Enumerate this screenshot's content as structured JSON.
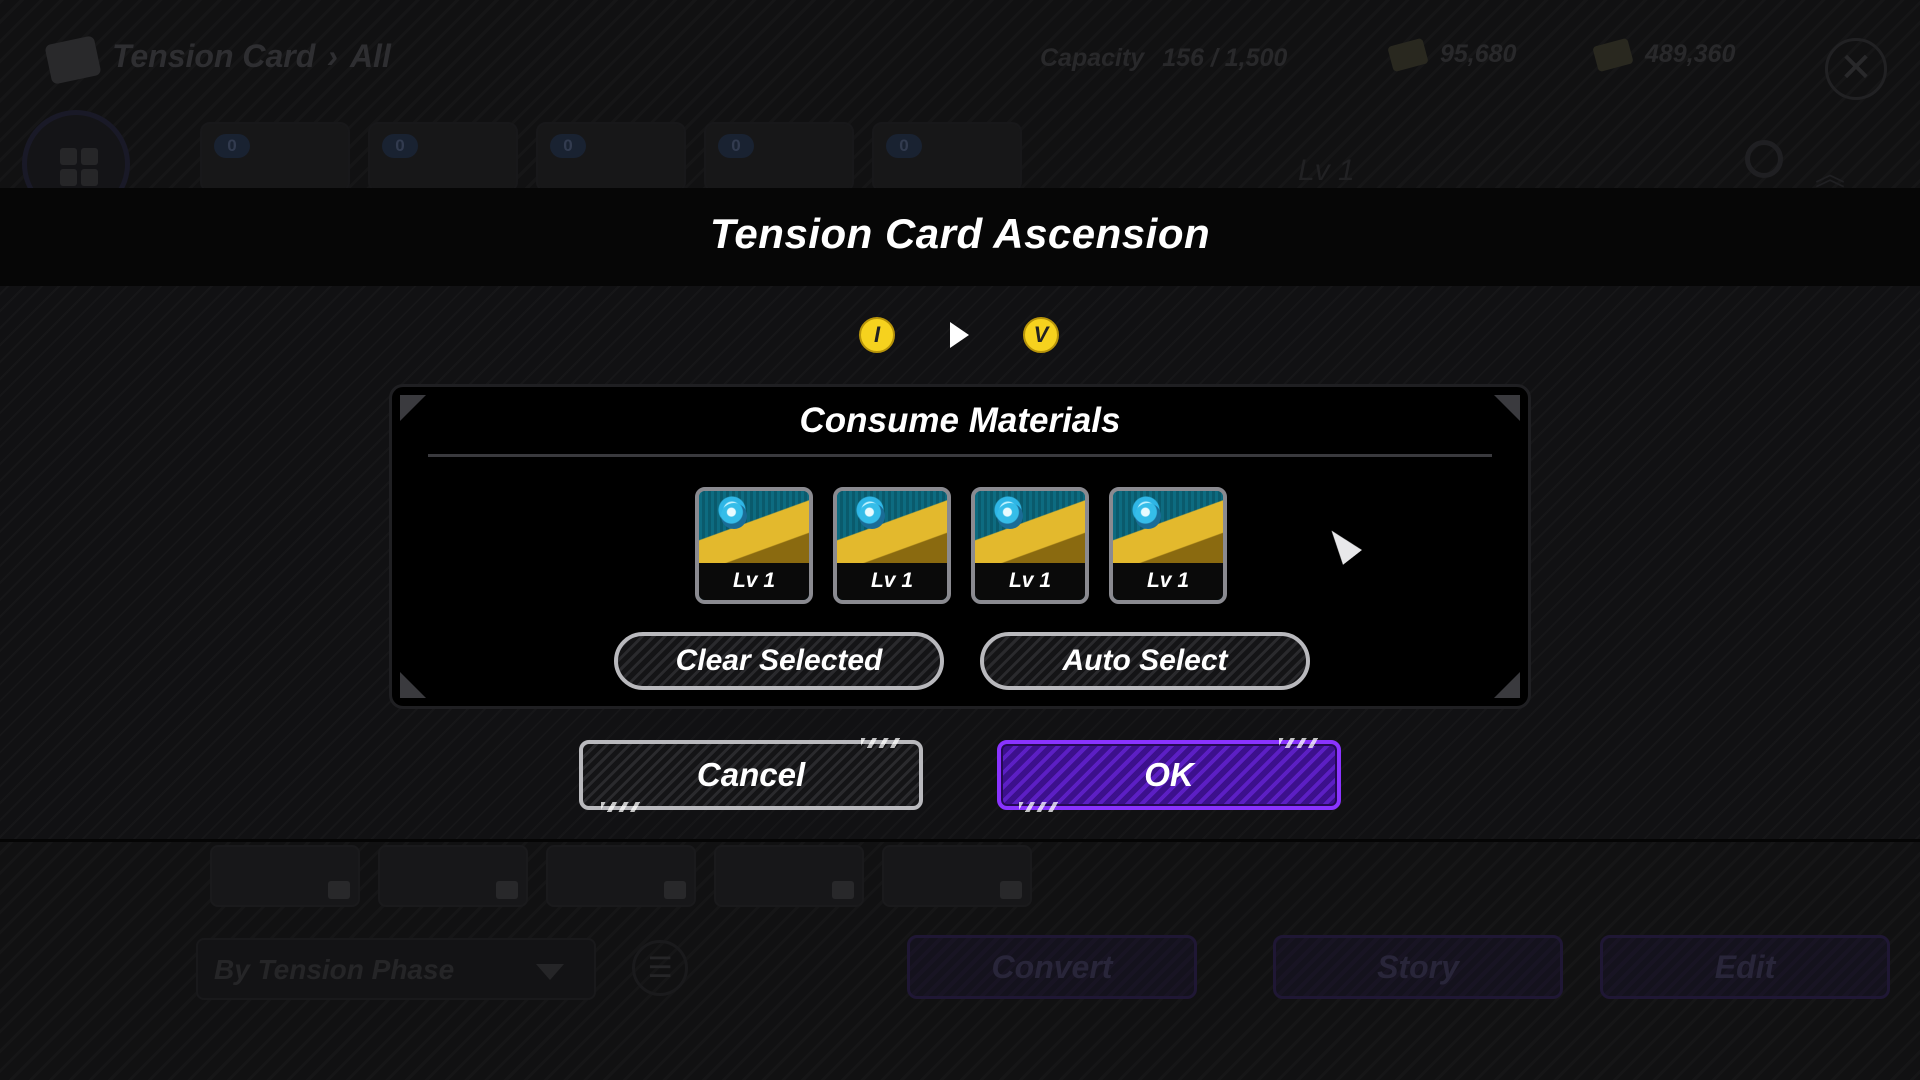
{
  "background": {
    "header": {
      "title": "Tension Card",
      "separator": "›",
      "filter": "All",
      "capacity_label": "Capacity",
      "capacity_value": "156 / 1,500",
      "currency_1": "95,680",
      "currency_2": "489,360",
      "level_text": "Lv 1",
      "slot_badges": [
        "0",
        "0",
        "0",
        "0",
        "0"
      ]
    },
    "footer": {
      "sort_label": "By Tension Phase",
      "buttons": [
        "Convert",
        "Story",
        "Edit"
      ]
    }
  },
  "modal": {
    "title": "Tension Card Ascension",
    "tier_from": "I",
    "tier_to": "V",
    "panel": {
      "title": "Consume Materials",
      "materials": [
        {
          "level": "Lv 1"
        },
        {
          "level": "Lv 1"
        },
        {
          "level": "Lv 1"
        },
        {
          "level": "Lv 1"
        }
      ],
      "clear_label": "Clear Selected",
      "auto_label": "Auto Select"
    },
    "cancel_label": "Cancel",
    "ok_label": "OK"
  },
  "colors": {
    "accent_purple": "#5c1fc4",
    "tier_gold": "#f6d21e",
    "material_bg": "#0b5f73"
  }
}
